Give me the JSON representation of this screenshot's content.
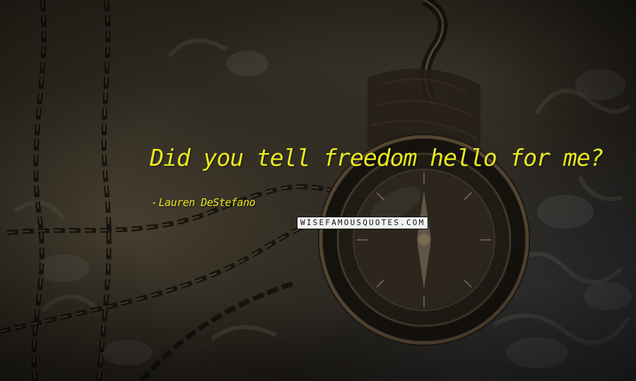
{
  "quote": {
    "text": "Did you tell freedom hello for me?",
    "author_dash": "-",
    "author": "Lauren DeStefano",
    "color": "#e8e820"
  },
  "watermark": {
    "text": "WISEFAMOUSQUOTES.COM"
  },
  "background": {
    "subject": "compass pendant with chains on floral fabric",
    "tone": "#2a261e"
  }
}
